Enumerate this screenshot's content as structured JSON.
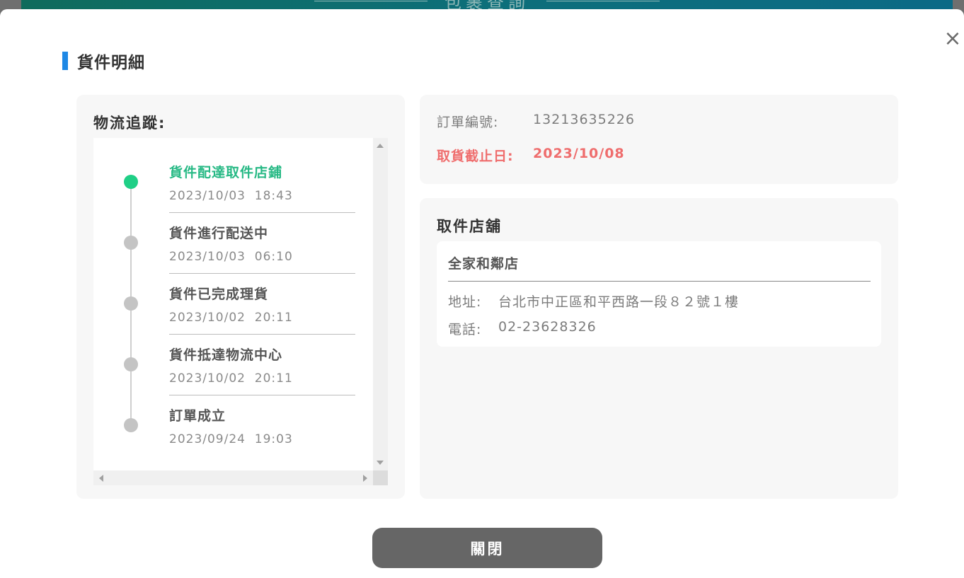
{
  "background": {
    "title": "包裹查詢"
  },
  "modal": {
    "title": "貨件明細",
    "close_icon": "×"
  },
  "tracking": {
    "heading": "物流追蹤:",
    "steps": [
      {
        "label": "貨件配達取件店鋪",
        "time": "2023/10/03  18:43",
        "status": "current"
      },
      {
        "label": "貨件進行配送中",
        "time": "2023/10/03  06:10",
        "status": "past"
      },
      {
        "label": "貨件已完成理貨",
        "time": "2023/10/02  20:11",
        "status": "past"
      },
      {
        "label": "貨件抵達物流中心",
        "time": "2023/10/02  20:11",
        "status": "past"
      },
      {
        "label": "訂單成立",
        "time": "2023/09/24  19:03",
        "status": "past"
      }
    ]
  },
  "order": {
    "number_label": "訂單編號:",
    "number_value": "13213635226",
    "deadline_label": "取貨截止日:",
    "deadline_value": "2023/10/08"
  },
  "store": {
    "heading": "取件店舖",
    "name": "全家和鄰店",
    "address_label": "地址:",
    "address_value": "台北市中正區和平西路一段８２號１樓",
    "phone_label": "電話:",
    "phone_value": "02-23628326"
  },
  "footer": {
    "close_label": "關閉"
  },
  "colors": {
    "accent": "#1e88e5",
    "active_step": "#27b985",
    "deadline": "#ef6d6d",
    "button": "#666666"
  }
}
